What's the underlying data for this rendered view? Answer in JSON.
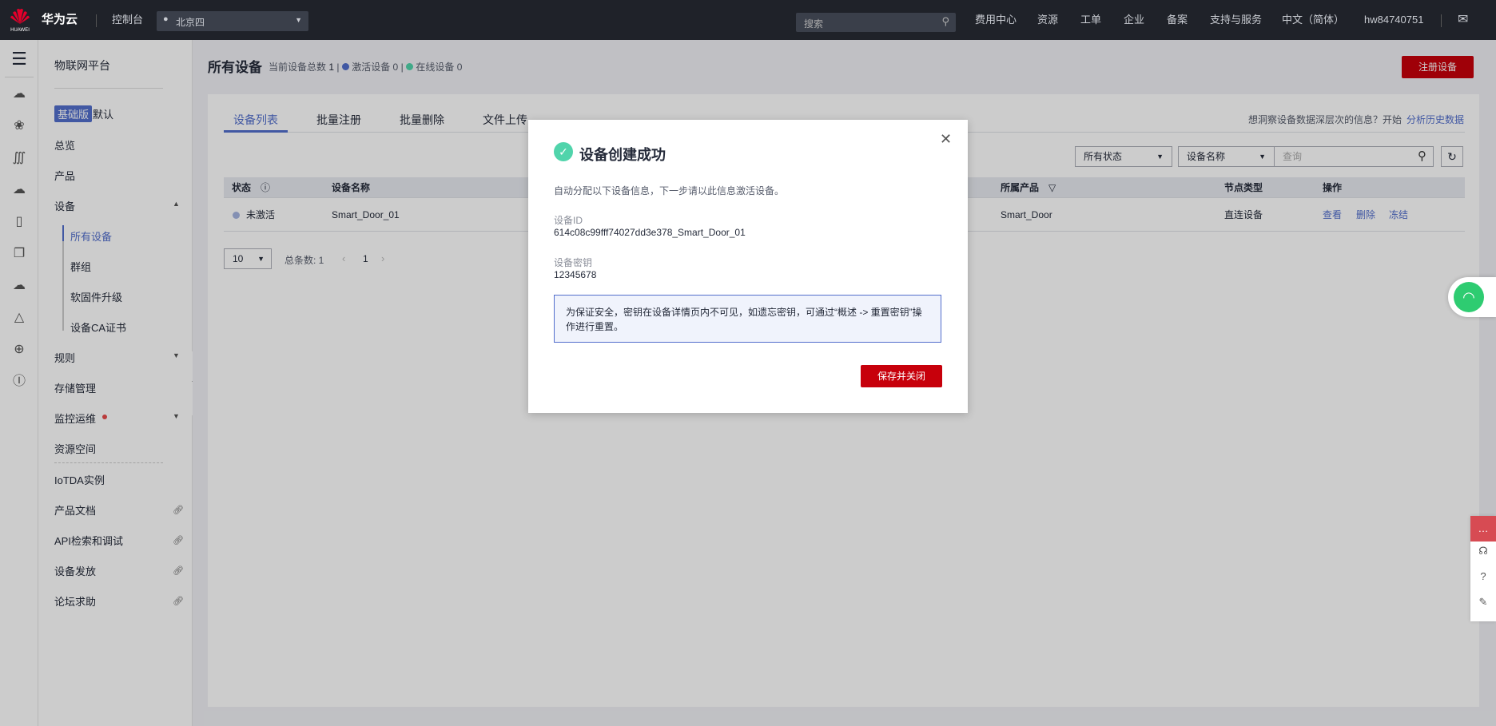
{
  "topbar": {
    "brand": "华为云",
    "logo_text": "HUAWEI",
    "console": "控制台",
    "region": "北京四",
    "search_placeholder": "搜索",
    "nav": [
      "费用中心",
      "资源",
      "工单",
      "企业",
      "备案",
      "支持与服务",
      "中文（简体）",
      "hw84740751"
    ]
  },
  "sidebar": {
    "title": "物联网平台",
    "edition_badge": "基础版",
    "edition_name": "默认",
    "items": [
      "总览",
      "产品",
      "设备",
      "所有设备",
      "群组",
      "软固件升级",
      "设备CA证书",
      "规则",
      "存储管理",
      "监控运维",
      "资源空间",
      "IoTDA实例",
      "产品文档",
      "API检索和调试",
      "设备发放",
      "论坛求助"
    ]
  },
  "header": {
    "title": "所有设备",
    "total_label": "当前设备总数",
    "total": "1",
    "active_label": "激活设备",
    "active": "0",
    "online_label": "在线设备",
    "online": "0",
    "register_button": "注册设备",
    "active_color": "#526ecc",
    "online_color": "#50d4ab"
  },
  "tabs": [
    "设备列表",
    "批量注册",
    "批量删除",
    "文件上传"
  ],
  "insight": {
    "text": "想洞察设备数据深层次的信息？开始",
    "link": "分析历史数据"
  },
  "filters": {
    "status": "所有状态",
    "field": "设备名称",
    "query_placeholder": "查询"
  },
  "table": {
    "columns": [
      "状态",
      "设备名称",
      "所属产品",
      "节点类型",
      "操作"
    ],
    "rows": [
      {
        "status": "未激活",
        "name": "Smart_Door_01",
        "product": "Smart_Door",
        "node_type": "直连设备",
        "actions": [
          "查看",
          "删除",
          "冻结"
        ]
      }
    ]
  },
  "pagination": {
    "page_size": "10",
    "total_label": "总条数: 1",
    "page": "1"
  },
  "modal": {
    "title": "设备创建成功",
    "desc": "自动分配以下设备信息，下一步请以此信息激活设备。",
    "id_label": "设备ID",
    "id_value": "614c08c99fff74027dd3e378_Smart_Door_01",
    "secret_label": "设备密钥",
    "secret_value": "12345678",
    "notice": "为保证安全，密钥在设备详情页内不可见，如遗忘密钥，可通过“概述 -> 重置密钥”操作进行重置。",
    "save_button": "保存并关闭",
    "accent": "#c7000b"
  }
}
